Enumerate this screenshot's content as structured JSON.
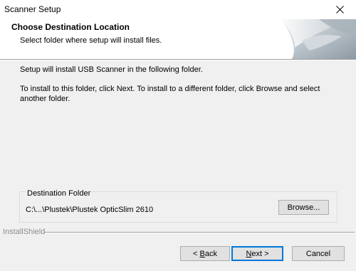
{
  "window": {
    "title": "Scanner Setup"
  },
  "header": {
    "title": "Choose Destination Location",
    "subtitle": "Select folder where setup will install files."
  },
  "body": {
    "line1": "Setup will install USB Scanner in the following folder.",
    "line2": "To install to this folder, click Next. To install to a different folder, click Browse and select another folder."
  },
  "destination": {
    "group_label": "Destination Folder",
    "path": "C:\\...\\Plustek\\Plustek OpticSlim 2610",
    "browse_label": "Browse..."
  },
  "footer": {
    "brand": "InstallShield",
    "back_accel": "B",
    "back_rest": "ack",
    "back_prefix": "< ",
    "next_accel": "N",
    "next_rest": "ext >",
    "cancel_label": "Cancel"
  },
  "icons": {
    "close": "close-icon",
    "header_art": "header-art-image"
  },
  "colors": {
    "default_button_border": "#0078d7",
    "button_face": "#e1e1e1",
    "dialog_bg": "#f0f0f0"
  }
}
